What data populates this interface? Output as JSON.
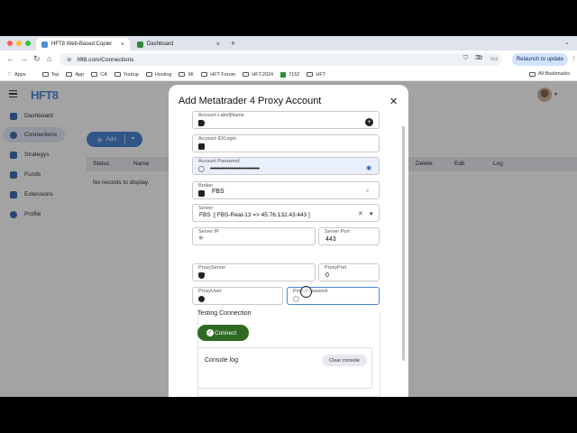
{
  "browser": {
    "tabs": [
      {
        "title": "HFT8 Web-Based Copier",
        "favicon": "hft8-favicon"
      },
      {
        "title": "Dashboard",
        "favicon": "hft8-dashboard-favicon"
      }
    ],
    "url": "hft8.com/Connections",
    "relaunch_label": "Relaunch to update",
    "bookmarks": [
      "Apps",
      "Top",
      "App",
      "CA",
      "Youtup",
      "Hosting",
      "9K",
      "HFT Forum",
      "HFT.2024",
      "7152",
      "HFT"
    ],
    "all_bookmarks_label": "All Bookmarks"
  },
  "app": {
    "logo": "HFT8",
    "nav": [
      {
        "label": "Dashboard",
        "icon": "dashboard-icon"
      },
      {
        "label": "Connections",
        "icon": "link-icon",
        "active": true
      },
      {
        "label": "Strategys",
        "icon": "strategy-icon"
      },
      {
        "label": "Funds",
        "icon": "funds-icon"
      },
      {
        "label": "Extensions",
        "icon": "puzzle-icon"
      },
      {
        "label": "Profile",
        "icon": "person-icon"
      }
    ],
    "add_button": "Add",
    "table_headers": [
      "Status",
      "Name",
      "Delete",
      "Edit",
      "Log"
    ],
    "empty_text": "No records to display."
  },
  "modal": {
    "title": "Add Metatrader 4 Proxy Account",
    "fields": {
      "account_label": {
        "label": "Account Label|Name",
        "value": ""
      },
      "account_id": {
        "label": "Account ID/Login",
        "value": ""
      },
      "account_password": {
        "label": "Account Password",
        "value": "••••••••••••••••••••••••••••"
      },
      "broker": {
        "label": "Broker",
        "value": "FBS"
      },
      "server": {
        "label": "Server",
        "value": "FBS :[ FBS-Real-13 => 45.76.132.43:443 ]"
      },
      "server_ip": {
        "label": "Server IP",
        "value": ""
      },
      "server_port": {
        "label": "Server Port",
        "value": "443"
      },
      "proxy_server": {
        "label": "ProxyServer",
        "value": ""
      },
      "proxy_port": {
        "label": "ProxyPort",
        "value": "0"
      },
      "proxy_user": {
        "label": "ProxyUser",
        "value": ""
      },
      "proxy_password": {
        "label": "ProxyPassword",
        "value": ""
      }
    },
    "testing_title": "Testing Connection",
    "connect_button": "Connect",
    "console_title": "Console log",
    "clear_button": "Clear console"
  },
  "colors": {
    "primary": "#4a86d6",
    "connect": "#2f6a23",
    "overlay": "rgba(0,0,0,0.36)"
  }
}
